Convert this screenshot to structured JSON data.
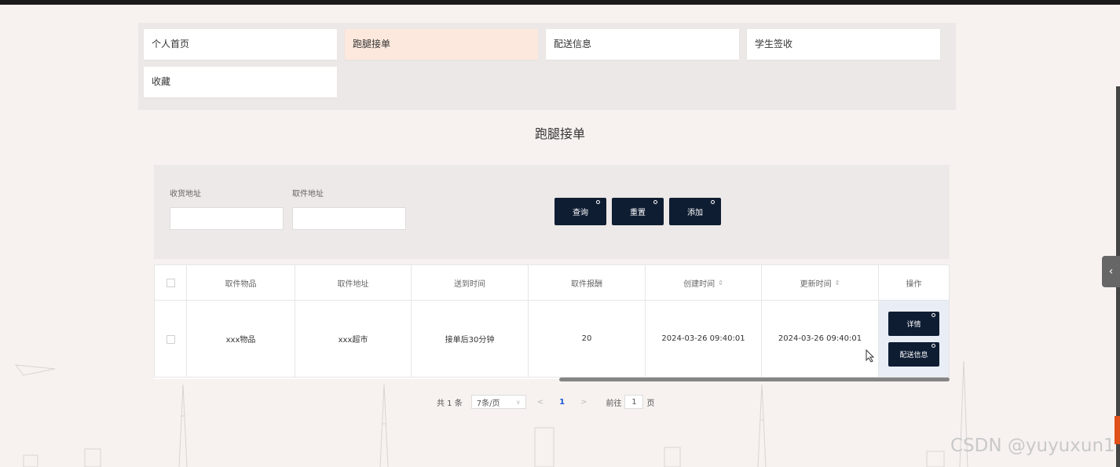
{
  "nav": {
    "items": [
      {
        "label": "个人首页",
        "active": false
      },
      {
        "label": "跑腿接单",
        "active": true
      },
      {
        "label": "配送信息",
        "active": false
      },
      {
        "label": "学生签收",
        "active": false
      },
      {
        "label": "收藏",
        "active": false
      }
    ]
  },
  "page": {
    "title": "跑腿接单"
  },
  "search": {
    "receive_address_label": "收货地址",
    "receive_address_value": "",
    "pickup_address_label": "取件地址",
    "pickup_address_value": "",
    "query_label": "查询",
    "reset_label": "重置",
    "add_label": "添加"
  },
  "table": {
    "headers": [
      "取件物品",
      "取件地址",
      "送到时间",
      "取件报酬",
      "创建时间",
      "更新时间",
      "操作"
    ],
    "sort_icon": "⇕",
    "rows": [
      {
        "item": "xxx物品",
        "address": "xxx超市",
        "delivery_time": "接单后30分钟",
        "reward": "20",
        "created": "2024-03-26 09:40:01",
        "updated": "2024-03-26 09:40:01",
        "detail_label": "详情",
        "delivery_info_label": "配送信息"
      }
    ]
  },
  "pagination": {
    "total": "共 1 条",
    "page_size": "7条/页",
    "current_page": "1",
    "goto_label": "前往",
    "goto_value": "1",
    "page_unit": "页"
  },
  "watermark": "CSDN @yuyuxun1",
  "colors": {
    "accent": "#0f1d33",
    "active_nav": "#fde8dd",
    "page_link": "#1a56d6"
  }
}
